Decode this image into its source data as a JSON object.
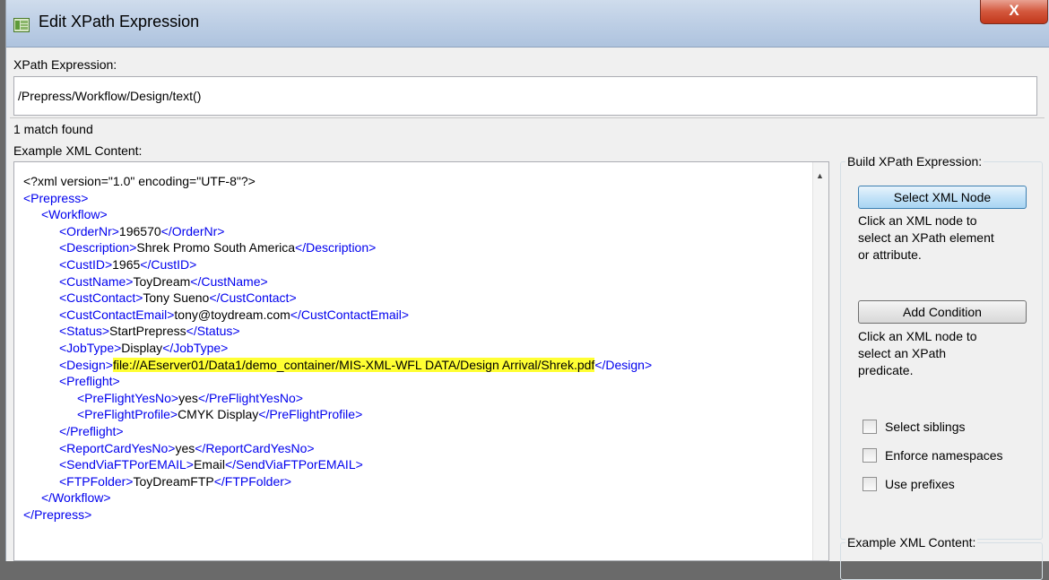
{
  "window": {
    "title": "Edit XPath Expression",
    "close_label": "X"
  },
  "xpath": {
    "label": "XPath Expression:",
    "value": "/Prepress/Workflow/Design/text()",
    "status": "1 match found"
  },
  "xml": {
    "label": "Example XML Content:",
    "lines": [
      {
        "indent": 0,
        "text": "<?xml version=\"1.0\" encoding=\"UTF-8\"?>",
        "type": "decl"
      },
      {
        "indent": 0,
        "open": "<Prepress>"
      },
      {
        "indent": 1,
        "open": "<Workflow>"
      },
      {
        "indent": 2,
        "open": "<OrderNr>",
        "value": "196570",
        "close": "</OrderNr>"
      },
      {
        "indent": 2,
        "open": "<Description>",
        "value": "Shrek Promo South America",
        "close": "</Description>"
      },
      {
        "indent": 2,
        "open": "<CustID>",
        "value": "1965",
        "close": "</CustID>"
      },
      {
        "indent": 2,
        "open": "<CustName>",
        "value": "ToyDream",
        "close": "</CustName>"
      },
      {
        "indent": 2,
        "open": "<CustContact>",
        "value": "Tony Sueno",
        "close": "</CustContact>"
      },
      {
        "indent": 2,
        "open": "<CustContactEmail>",
        "value": "tony@toydream.com",
        "close": "</CustContactEmail>"
      },
      {
        "indent": 2,
        "open": "<Status>",
        "value": "StartPrepress",
        "close": "</Status>"
      },
      {
        "indent": 2,
        "open": "<JobType>",
        "value": "Display",
        "close": "</JobType>"
      },
      {
        "indent": 2,
        "open": "<Design>",
        "value": "file://AEserver01/Data1/demo_container/MIS-XML-WFL DATA/Design Arrival/Shrek.pdf",
        "close": "</Design>",
        "highlight": true
      },
      {
        "indent": 2,
        "open": "<Preflight>"
      },
      {
        "indent": 3,
        "open": "<PreFlightYesNo>",
        "value": "yes",
        "close": "</PreFlightYesNo>"
      },
      {
        "indent": 3,
        "open": "<PreFlightProfile>",
        "value": "CMYK Display",
        "close": "</PreFlightProfile>"
      },
      {
        "indent": 2,
        "open": "</Preflight>"
      },
      {
        "indent": 2,
        "open": "<ReportCardYesNo>",
        "value": "yes",
        "close": "</ReportCardYesNo>"
      },
      {
        "indent": 2,
        "open": "<SendViaFTPorEMAIL>",
        "value": "Email",
        "close": "</SendViaFTPorEMAIL>"
      },
      {
        "indent": 2,
        "open": "<FTPFolder>",
        "value": "ToyDreamFTP",
        "close": "</FTPFolder>"
      },
      {
        "indent": 1,
        "open": "</Workflow>"
      },
      {
        "indent": 0,
        "open": "</Prepress>"
      }
    ]
  },
  "builder": {
    "title": "Build XPath Expression:",
    "select_node_label": "Select XML Node",
    "select_node_help": [
      "Click an XML node to",
      "select an XPath element",
      "or attribute."
    ],
    "add_condition_label": "Add Condition",
    "add_condition_help": [
      "Click an XML node to",
      "select an XPath",
      "predicate."
    ],
    "checkboxes": [
      {
        "label": "Select siblings",
        "checked": false
      },
      {
        "label": "Enforce namespaces",
        "checked": false
      },
      {
        "label": "Use prefixes",
        "checked": false
      }
    ]
  },
  "example_group": {
    "title": "Example XML Content:"
  },
  "colors": {
    "tag": "#0000ee",
    "highlight": "#ffff33"
  }
}
